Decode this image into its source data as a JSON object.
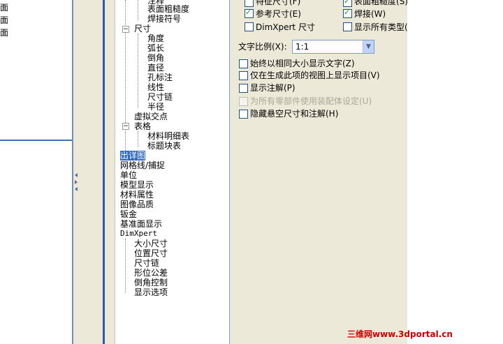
{
  "left_panel": {
    "items": [
      "面",
      "面",
      "面"
    ]
  },
  "tree": {
    "items": [
      {
        "label": "注释",
        "level": 2
      },
      {
        "label": "表面粗糙度",
        "level": 2
      },
      {
        "label": "焊接符号",
        "level": 2
      },
      {
        "label": "尺寸",
        "level": 1,
        "expander": "−"
      },
      {
        "label": "角度",
        "level": 2
      },
      {
        "label": "弧长",
        "level": 2
      },
      {
        "label": "倒角",
        "level": 2
      },
      {
        "label": "直径",
        "level": 2
      },
      {
        "label": "孔标注",
        "level": 2
      },
      {
        "label": "线性",
        "level": 2
      },
      {
        "label": "尺寸链",
        "level": 2
      },
      {
        "label": "半径",
        "level": 2
      },
      {
        "label": "虚拟交点",
        "level": 1
      },
      {
        "label": "表格",
        "level": 1,
        "expander": "−"
      },
      {
        "label": "材料明细表",
        "level": 2
      },
      {
        "label": "标题块表",
        "level": 2
      },
      {
        "label": "出详图",
        "level": 0,
        "selected": true
      },
      {
        "label": "网格线/捕捉",
        "level": 0
      },
      {
        "label": "单位",
        "level": 0
      },
      {
        "label": "模型显示",
        "level": 0
      },
      {
        "label": "材料属性",
        "level": 0
      },
      {
        "label": "图像品质",
        "level": 0
      },
      {
        "label": "钣金",
        "level": 0
      },
      {
        "label": "基准面显示",
        "level": 0
      },
      {
        "label": "DimXpert",
        "level": 0,
        "expander": "−"
      },
      {
        "label": "大小尺寸",
        "level": 1
      },
      {
        "label": "位置尺寸",
        "level": 1
      },
      {
        "label": "尺寸链",
        "level": 1
      },
      {
        "label": "形位公差",
        "level": 1
      },
      {
        "label": "倒角控制",
        "level": 1
      },
      {
        "label": "显示选项",
        "level": 1
      }
    ]
  },
  "options": {
    "top_checks": [
      {
        "label": "特征尺寸(F)",
        "checked": false
      },
      {
        "label": "表面粗糙度(S)",
        "checked": true
      },
      {
        "label": "参考尺寸(E)",
        "checked": true
      },
      {
        "label": "焊接(W)",
        "checked": true
      },
      {
        "label": "DimXpert 尺寸",
        "checked": false
      },
      {
        "label": "显示所有类型(",
        "checked": false
      }
    ],
    "scale_label": "文字比例(X):",
    "scale_value": "1:1",
    "checks": [
      {
        "label": "始终以相同大小显示文字(Z)",
        "checked": false,
        "disabled": false
      },
      {
        "label": "仅在生成此项的视图上显示项目(V)",
        "checked": false,
        "disabled": false
      },
      {
        "label": "显示注解(P)",
        "checked": false,
        "disabled": false
      },
      {
        "label": "为所有零部件使用装配体设定(U)",
        "checked": false,
        "disabled": true
      },
      {
        "label": "隐藏悬空尺寸和注解(H)",
        "checked": false,
        "disabled": false
      }
    ]
  },
  "watermark": "三维网www.3dportal.cn"
}
